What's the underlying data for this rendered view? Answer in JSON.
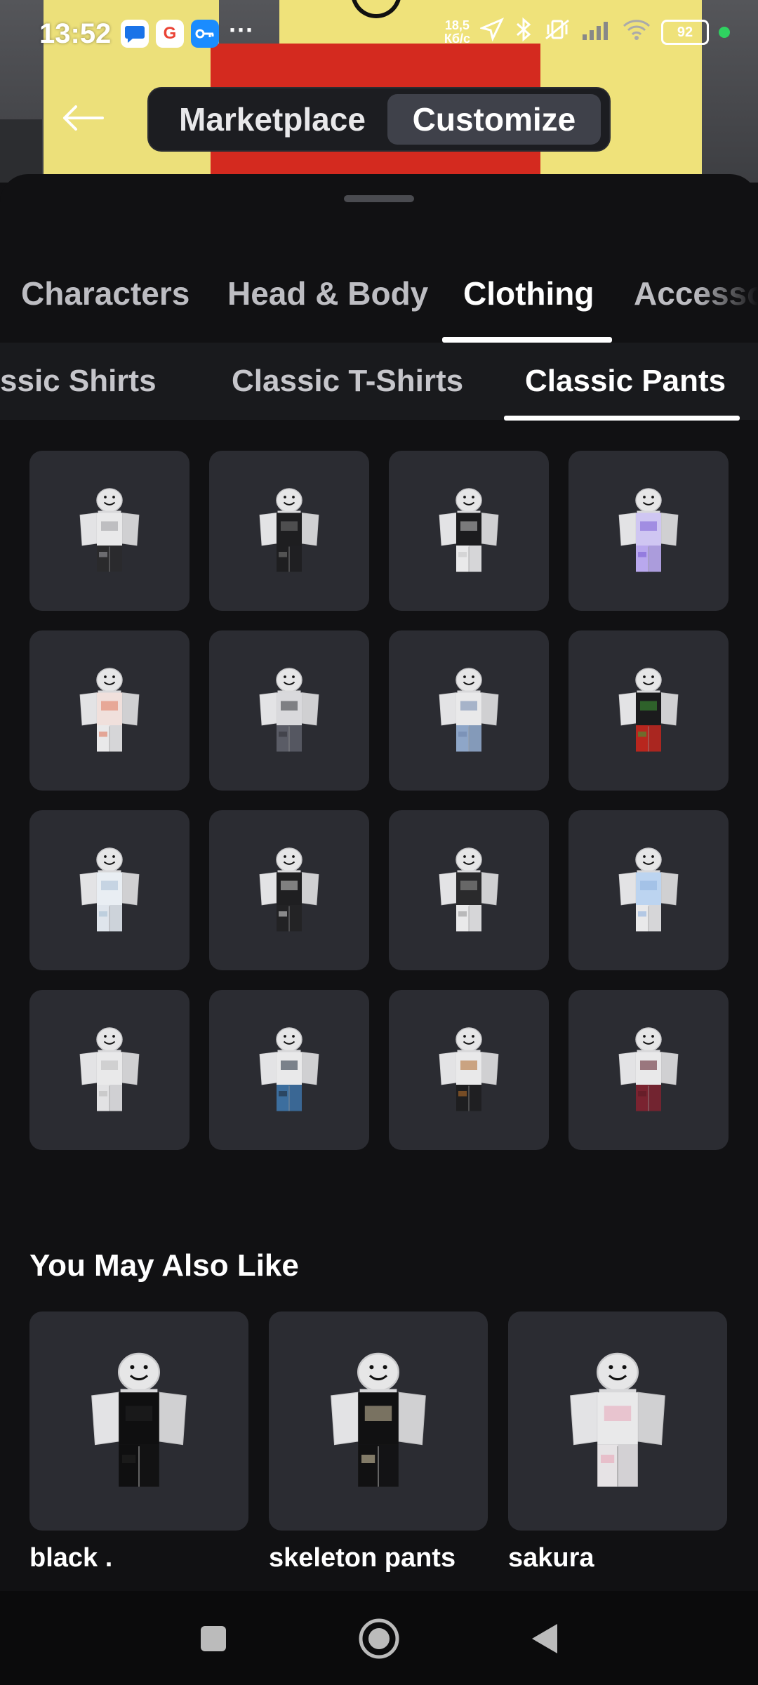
{
  "status_bar": {
    "time": "13:52",
    "apps": [
      "messages-icon",
      "google-icon",
      "key-icon"
    ],
    "more": "···",
    "speed_value": "18,5",
    "speed_unit": "Кб/с",
    "battery": "92"
  },
  "header": {
    "marketplace_label": "Marketplace",
    "customize_label": "Customize"
  },
  "tabs": [
    "Characters",
    "Head & Body",
    "Clothing",
    "Accesso"
  ],
  "subtabs": [
    "ssic Shirts",
    "Classic T-Shirts",
    "Classic Pants"
  ],
  "grid_items": [
    {
      "pants": "#2a2a2c",
      "shirt": "#e9e9ea",
      "accent": "#9a9a9e"
    },
    {
      "pants": "#1e1e20",
      "shirt": "#1e1e20",
      "accent": "#777"
    },
    {
      "pants": "#e9e9ea",
      "shirt": "#1c1c1e",
      "accent": "#c8c8c8"
    },
    {
      "pants": "#b9a8ee",
      "shirt": "#cfc6f2",
      "accent": "#7b5fd6"
    },
    {
      "pants": "#e9e9ea",
      "shirt": "#f0e0dc",
      "accent": "#e07a5f"
    },
    {
      "pants": "#5a5c66",
      "shirt": "#d9d9dc",
      "accent": "#33343a"
    },
    {
      "pants": "#8ea6c8",
      "shirt": "#e9e9ea",
      "accent": "#6f87ad"
    },
    {
      "pants": "#b8261e",
      "shirt": "#1b1b1d",
      "accent": "#3e9a35"
    },
    {
      "pants": "#dfe5ec",
      "shirt": "#e9eef3",
      "accent": "#a9bfd6"
    },
    {
      "pants": "#222224",
      "shirt": "#1f1f21",
      "accent": "#d0d0d0"
    },
    {
      "pants": "#e9e9ea",
      "shirt": "#2a2a2c",
      "accent": "#999"
    },
    {
      "pants": "#e9e9ea",
      "shirt": "#bcd4f0",
      "accent": "#8fb3e0"
    },
    {
      "pants": "#e2e2e4",
      "shirt": "#e9e9ea",
      "accent": "#bbb"
    },
    {
      "pants": "#3c6e9e",
      "shirt": "#e9e9ea",
      "accent": "#1f2c3a"
    },
    {
      "pants": "#1e1e20",
      "shirt": "#e9e9ea",
      "accent": "#b06a2a"
    },
    {
      "pants": "#7a2330",
      "shirt": "#e9e9ea",
      "accent": "#5a1a24"
    }
  ],
  "you_may_also_like": {
    "title": "You May Also Like",
    "items": [
      {
        "name": "black  .",
        "pants": "#0f0f10",
        "shirt": "#0f0f10",
        "accent": "#222"
      },
      {
        "name": "skeleton pants",
        "pants": "#111112",
        "shirt": "#111112",
        "accent": "#cfc3a2"
      },
      {
        "name": "sakura",
        "pants": "#e6e3e5",
        "shirt": "#e9e9ea",
        "accent": "#e7a6b8"
      }
    ]
  },
  "nav": [
    "recents-square-icon",
    "home-circle-icon",
    "back-triangle-icon"
  ]
}
